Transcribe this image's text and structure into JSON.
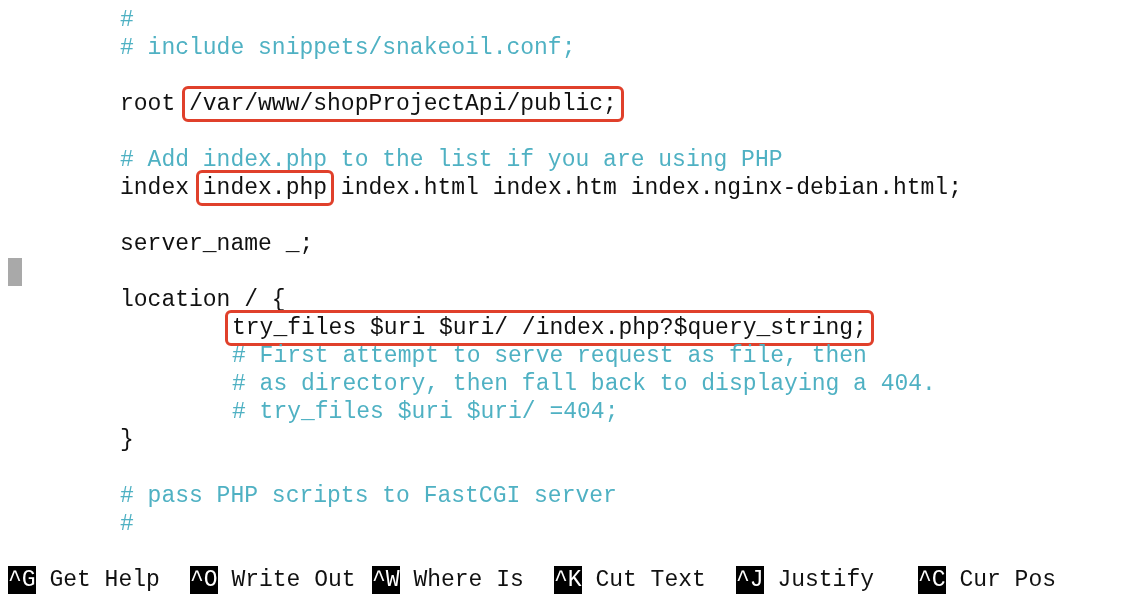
{
  "editor": {
    "lines": [
      {
        "kind": "comment",
        "text": "#"
      },
      {
        "kind": "comment",
        "text": "# include snippets/snakeoil.conf;"
      },
      {
        "kind": "blank"
      },
      {
        "kind": "code",
        "segments": [
          {
            "kind": "plain",
            "text": "root"
          },
          {
            "kind": "marked",
            "text": "/var/www/shopProjectApi/public;"
          }
        ]
      },
      {
        "kind": "blank"
      },
      {
        "kind": "comment",
        "text": "# Add index.php to the list if you are using PHP"
      },
      {
        "kind": "code",
        "segments": [
          {
            "kind": "plain",
            "text": "index"
          },
          {
            "kind": "marked",
            "text": "index.php"
          },
          {
            "kind": "plain",
            "text": "index.html index.htm index.nginx-debian.html;"
          }
        ]
      },
      {
        "kind": "blank"
      },
      {
        "kind": "code",
        "text": "server_name _;"
      },
      {
        "kind": "cursor"
      },
      {
        "kind": "code",
        "text": "location / {",
        "children": [
          {
            "kind": "code",
            "segments": [
              {
                "kind": "marked",
                "text": "try_files $uri $uri/ /index.php?$query_string;"
              }
            ]
          },
          {
            "kind": "comment",
            "text": "# First attempt to serve request as file, then"
          },
          {
            "kind": "comment",
            "text": "# as directory, then fall back to displaying a 404."
          },
          {
            "kind": "comment",
            "text": "# try_files $uri $uri/ =404;"
          }
        ]
      },
      {
        "kind": "code",
        "text": "}"
      },
      {
        "kind": "blank"
      },
      {
        "kind": "comment",
        "text": "# pass PHP scripts to FastCGI server"
      },
      {
        "kind": "comment",
        "text": "#"
      },
      {
        "kind": "blank"
      }
    ]
  },
  "shortcuts": [
    [
      {
        "key": "^G",
        "label": "Get Help"
      },
      {
        "key": "^O",
        "label": "Write Out"
      },
      {
        "key": "^W",
        "label": "Where Is"
      },
      {
        "key": "^K",
        "label": "Cut Text"
      },
      {
        "key": "^J",
        "label": "Justify"
      },
      {
        "key": "^C",
        "label": "Cur Pos"
      }
    ]
  ]
}
